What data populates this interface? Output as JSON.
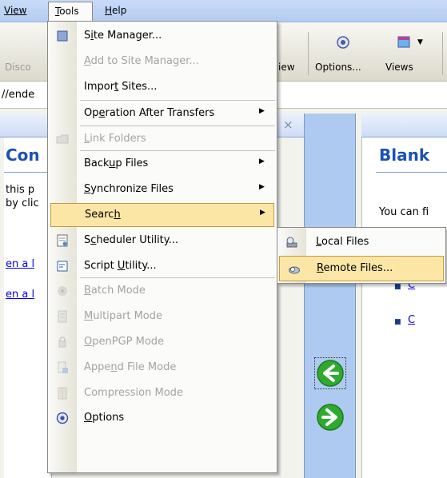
{
  "menubar": {
    "view": "View",
    "tools": "Tools",
    "help": "Help"
  },
  "toolbar": {
    "disconnect": "Disco",
    "view": "iew",
    "options": "Options...",
    "views": "Views"
  },
  "address": {
    "value": "//ende"
  },
  "left_pane": {
    "title": "Con",
    "text_line1": "this p",
    "text_line2": "by clic",
    "link1": "en a l",
    "link2": "en a l"
  },
  "right_pane": {
    "title": "Blank",
    "text_line1": "You can fi",
    "bullet1": "C",
    "bullet2": "C"
  },
  "tools_menu": {
    "items": [
      {
        "pre": "S",
        "acc": "i",
        "post": "te Manager...",
        "icon": "site-manager-icon",
        "enabled": true
      },
      {
        "pre": "",
        "acc": "A",
        "post": "dd to Site Manager...",
        "icon": "none",
        "enabled": false
      },
      {
        "pre": "Impor",
        "acc": "t",
        "post": " Sites...",
        "icon": "none",
        "enabled": true
      },
      {
        "pre": "Op",
        "acc": "e",
        "post": "ration After Transfers",
        "icon": "none",
        "enabled": true,
        "submenu": true
      },
      {
        "pre": "",
        "acc": "L",
        "post": "ink Folders",
        "icon": "link-folders-icon",
        "enabled": false
      },
      {
        "pre": "Back",
        "acc": "u",
        "post": "p Files",
        "icon": "none",
        "enabled": true,
        "submenu": true
      },
      {
        "pre": "",
        "acc": "S",
        "post": "ynchronize Files",
        "icon": "none",
        "enabled": true,
        "submenu": true
      },
      {
        "pre": "Searc",
        "acc": "h",
        "post": "",
        "icon": "none",
        "enabled": true,
        "submenu": true,
        "highlighted": true
      },
      {
        "pre": "S",
        "acc": "c",
        "post": "heduler Utility...",
        "icon": "scheduler-icon",
        "enabled": true
      },
      {
        "pre": "Script ",
        "acc": "U",
        "post": "tility...",
        "icon": "script-icon",
        "enabled": true
      },
      {
        "pre": "",
        "acc": "B",
        "post": "atch Mode",
        "icon": "batch-mode-icon",
        "enabled": false
      },
      {
        "pre": "",
        "acc": "M",
        "post": "ultipart Mode",
        "icon": "multipart-icon",
        "enabled": false
      },
      {
        "pre": "",
        "acc": "O",
        "post": "penPGP Mode",
        "icon": "lock-icon",
        "enabled": false
      },
      {
        "pre": "Appe",
        "acc": "n",
        "post": "d File Mode",
        "icon": "append-file-icon",
        "enabled": false
      },
      {
        "pre": "Compression Mode",
        "acc": "",
        "post": "",
        "icon": "compression-icon",
        "enabled": false
      },
      {
        "pre": "",
        "acc": "O",
        "post": "ptions",
        "icon": "options-icon",
        "enabled": true
      }
    ]
  },
  "search_submenu": {
    "items": [
      {
        "pre": "",
        "acc": "L",
        "post": "ocal Files",
        "icon": "local-files-icon"
      },
      {
        "pre": "",
        "acc": "R",
        "post": "emote Files...",
        "icon": "remote-files-icon",
        "highlighted": true
      }
    ]
  },
  "colors": {
    "menu_highlight": "#fbe6a6",
    "menu_highlight_border": "#c79a35",
    "disabled_text": "#a4a3a0",
    "pane_title": "#1b52b3",
    "arrow_green": "#2eaa2e"
  }
}
